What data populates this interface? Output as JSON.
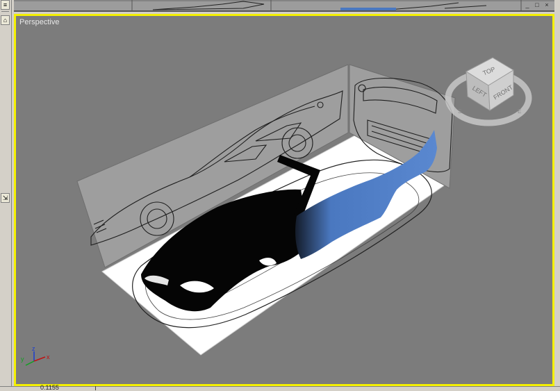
{
  "viewport": {
    "label": "Perspective",
    "border_color": "#f4f000",
    "background": "#7c7c7c"
  },
  "viewcube": {
    "faces": [
      "TOP",
      "LEFT",
      "FRONT"
    ],
    "compass": [
      "S",
      "E"
    ]
  },
  "axis_tripod": {
    "x": "x",
    "y": "y",
    "z": "z"
  },
  "top_viewport": {
    "controls": [
      "_",
      "□",
      "×"
    ]
  },
  "left_strip": {
    "icons": [
      "viewport-config-icon",
      "arc-rotate-icon",
      "maximize-icon"
    ]
  },
  "status": {
    "fragment": "0.1155"
  },
  "colors": {
    "accent_blue": "#4a78c0",
    "shell_black": "#050505"
  }
}
